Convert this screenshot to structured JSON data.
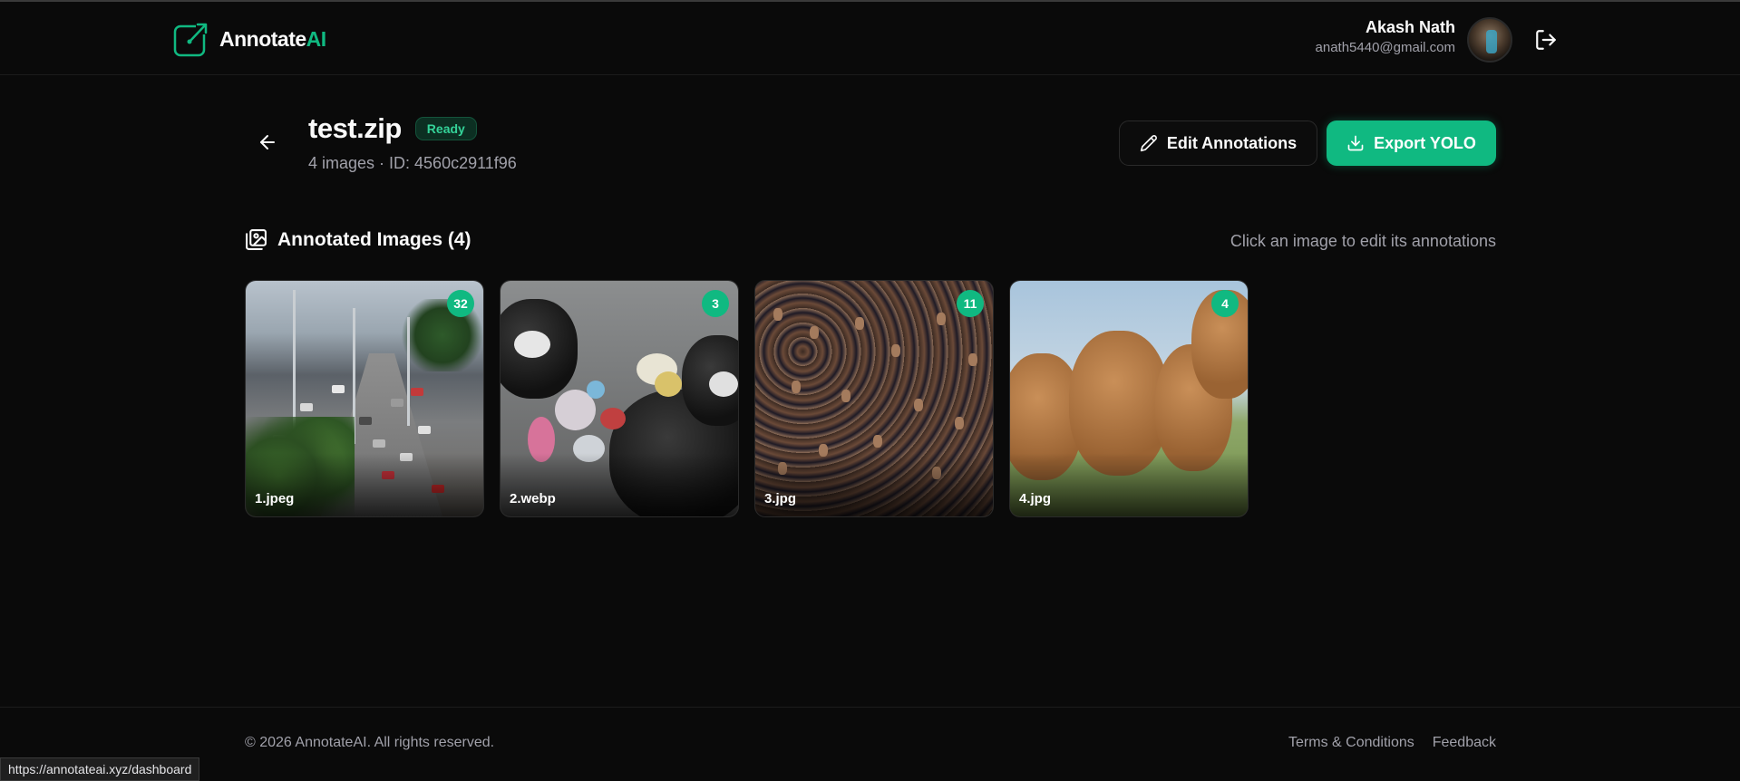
{
  "header": {
    "logo_text_main": "Annotate",
    "logo_text_accent": "AI",
    "user_name": "Akash Nath",
    "user_email": "anath5440@gmail.com"
  },
  "dataset": {
    "title": "test.zip",
    "status": "Ready",
    "subtitle": "4 images · ID: 4560c2911f96"
  },
  "actions": {
    "edit_label": "Edit Annotations",
    "export_label": "Export YOLO"
  },
  "section": {
    "title": "Annotated Images (4)",
    "hint": "Click an image to edit its annotations"
  },
  "images": [
    {
      "filename": "1.jpeg",
      "count": "32"
    },
    {
      "filename": "2.webp",
      "count": "3"
    },
    {
      "filename": "3.jpg",
      "count": "11"
    },
    {
      "filename": "4.jpg",
      "count": "4"
    }
  ],
  "footer": {
    "copyright": "© 2026 AnnotateAI. All rights reserved.",
    "terms": "Terms & Conditions",
    "feedback": "Feedback"
  },
  "status_bar": {
    "url": "https://annotateai.xyz/dashboard"
  },
  "colors": {
    "accent": "#10b981",
    "background": "#0a0a0a"
  },
  "icons": [
    "logo-icon",
    "logout-icon",
    "arrow-left-icon",
    "pencil-icon",
    "download-icon",
    "images-icon"
  ]
}
